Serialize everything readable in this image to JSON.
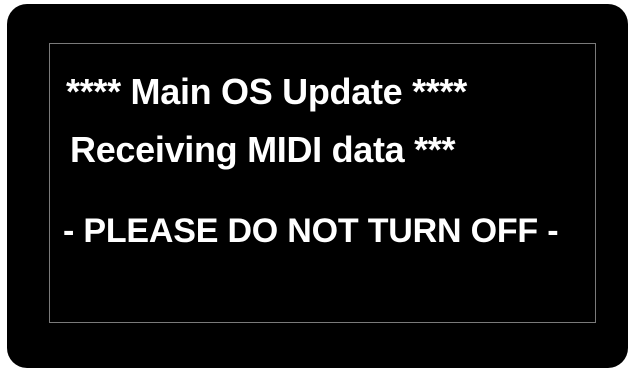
{
  "display": {
    "line1": "**** Main OS Update ****",
    "line2": "Receiving MIDI data ***",
    "line3": "- PLEASE DO NOT TURN OFF -"
  },
  "colors": {
    "screen_background": "#000000",
    "text": "#ffffff",
    "frame_border": "#7a7a7a",
    "page_background": "#ffffff"
  }
}
